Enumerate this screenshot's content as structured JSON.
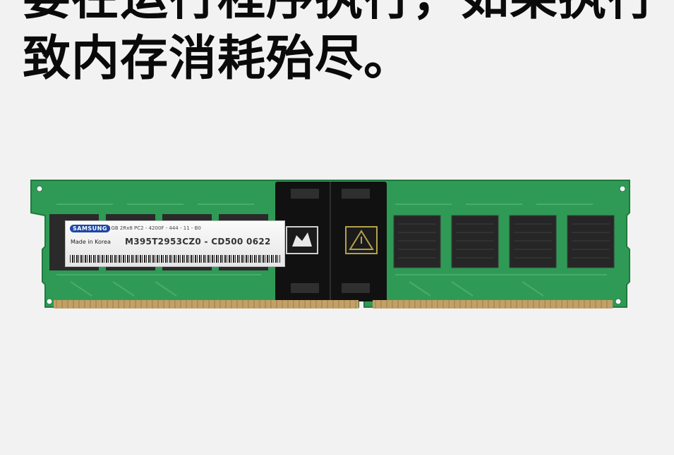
{
  "headline": {
    "line1": "要在运行程序执行，如果执行",
    "line2": "致内存消耗殆尽。"
  },
  "ram_label": {
    "brand": "SAMSUNG",
    "spec": "1GB 2Rx8 PC2 - 4200F - 444 - 11 - B0",
    "origin": "Made in Korea",
    "part_number": "M395T2953CZ0 - CD500 0622"
  },
  "colors": {
    "background": "#f2f2f2",
    "pcb": "#2f9a55",
    "chip": "#2a2a2a",
    "heat_spreader": "#111111",
    "gold_contacts": "#c2a067"
  }
}
